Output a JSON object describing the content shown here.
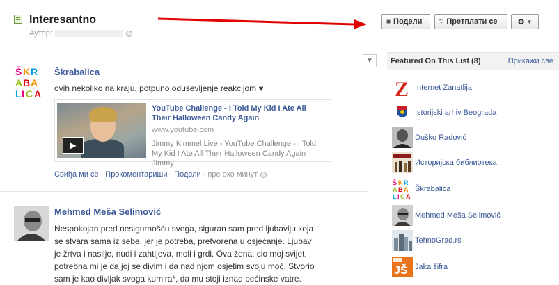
{
  "header": {
    "title": "Interesantno",
    "author_label": "Аутор:",
    "share_label": "Подели",
    "subscribe_label": "Претплати се"
  },
  "feed": {
    "stories": [
      {
        "name": "Škrabalica",
        "text": "ovih nekoliko na kraju, potpuno oduševljenje reakcijom ♥",
        "attachment": {
          "title": "YouTube Challenge - I Told My Kid I Ate All Their Halloween Candy Again",
          "url": "www.youtube.com",
          "description": "Jimmy Kimmel Live - YouTube Challenge - I Told My Kid I Ate All Their Halloween Candy Again Jimmy"
        },
        "actions": {
          "like": "Свиђа ми се",
          "comment": "Прокоментариши",
          "share": "Подели",
          "time": "пре око минут"
        }
      },
      {
        "name": "Mehmed Meša Selimović",
        "text_lines": [
          "Nespokojan pred nesigurnošću svega, siguran sam pred ljubavlju koja",
          "se stvara sama iz sebe, jer je potreba, pretvorena u osjećanje. Ljubav",
          "je žrtva i nasilje, nudi i zahtijeva, moli i grdi. Ova žena, cio moj svijet,",
          "potrebna mi je da joj se divim i da nad njom osjetim svoju moć. Stvorio",
          "sam je kao divljak svoga kumira*, da mu stoji iznad pećinske vatre."
        ]
      }
    ]
  },
  "sidebar": {
    "title": "Featured On This List (8)",
    "see_all": "Прикажи све",
    "items": [
      {
        "label": "Internet Zanatlija",
        "color": "#d42a20"
      },
      {
        "label": "Istorijski arhiv Beograda",
        "color": "#1d4f9c"
      },
      {
        "label": "Duško Radović",
        "color": "#555555"
      },
      {
        "label": "Историјска библиотека",
        "color": "#8b1a1a"
      },
      {
        "label": "Škrabalica",
        "color": "#c0185e"
      },
      {
        "label": "Mehmed Meša Selimović",
        "color": "#666666"
      },
      {
        "label": "TehnoGrad.rs",
        "color": "#7a8c9a"
      },
      {
        "label": "Jaka šifra",
        "color": "#e8731a"
      }
    ]
  },
  "colors": {
    "link": "#3b5998",
    "arrow": "#e00000"
  }
}
